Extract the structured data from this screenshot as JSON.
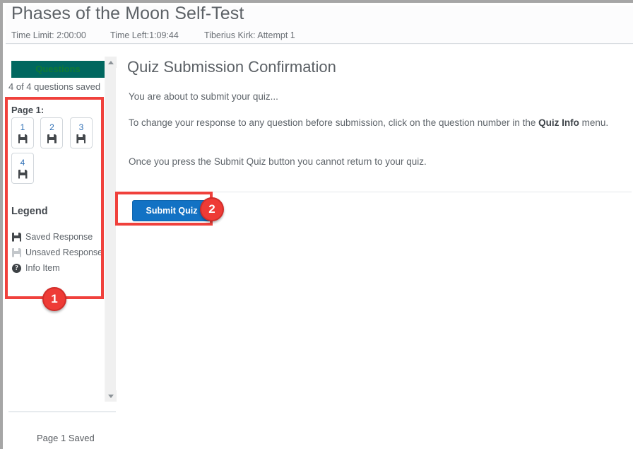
{
  "header": {
    "title": "Phases of the Moon Self-Test",
    "time_limit": "Time Limit: 2:00:00",
    "time_left": "Time Left:1:09:44",
    "user_attempt": "Tiberius Kirk: Attempt 1"
  },
  "sidebar": {
    "tab_label": "Questions",
    "saved_count": "4 of 4 questions saved",
    "page_label": "Page 1:",
    "questions": [
      {
        "number": "1",
        "state": "saved"
      },
      {
        "number": "2",
        "state": "saved"
      },
      {
        "number": "3",
        "state": "saved"
      },
      {
        "number": "4",
        "state": "saved"
      }
    ],
    "legend_title": "Legend",
    "legend": [
      {
        "icon": "saved-response-icon",
        "label": "Saved Response"
      },
      {
        "icon": "unsaved-response-icon",
        "label": "Unsaved Response"
      },
      {
        "icon": "info-item-icon",
        "label": "Info Item"
      }
    ],
    "status": "Page 1 Saved"
  },
  "main": {
    "title": "Quiz Submission Confirmation",
    "para_1": "You are about to submit your quiz...",
    "para_2_before": "To change your response to any question before submission, click on the question number in the ",
    "para_2_bold": "Quiz Info",
    "para_2_after": " menu.",
    "para_3": "Once you press the Submit Quiz button you cannot return to your quiz.",
    "submit_label": "Submit Quiz"
  },
  "annotations": {
    "badge_1": "1",
    "badge_2": "2"
  },
  "colors": {
    "tab_background": "#00675f",
    "tab_text": "#0f7a34",
    "submit_button": "#1272c4",
    "annotation_red": "#f0413c",
    "badge_red": "#ee3b36",
    "question_number_blue": "#2f6fb5"
  }
}
